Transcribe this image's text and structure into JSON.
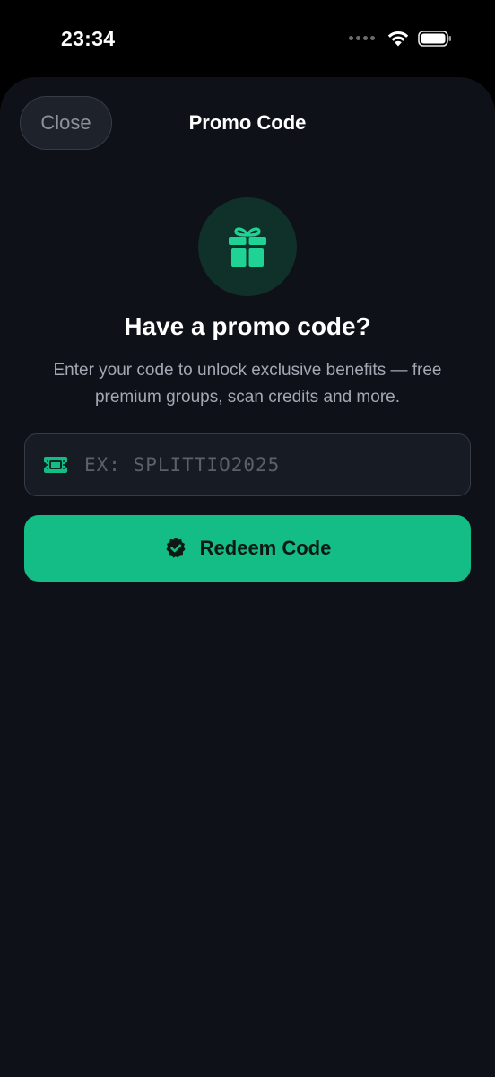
{
  "status_bar": {
    "time": "23:34"
  },
  "sheet": {
    "close_label": "Close",
    "title": "Promo Code"
  },
  "promo": {
    "headline": "Have a promo code?",
    "description": "Enter your code to unlock exclusive benefits — free premium groups, scan credits and more.",
    "input_placeholder": "EX: SPLITTIO2025",
    "input_value": "",
    "redeem_label": "Redeem Code"
  },
  "icons": {
    "gift": "gift-icon",
    "ticket": "ticket-icon",
    "verified": "verified-badge-icon",
    "wifi": "wifi-icon",
    "battery": "battery-icon",
    "signal": "cellular-signal-icon"
  },
  "colors": {
    "accent": "#13bd85",
    "sheet_background": "#0e1118",
    "gift_circle": "#10302a",
    "field_background": "#171b23"
  }
}
